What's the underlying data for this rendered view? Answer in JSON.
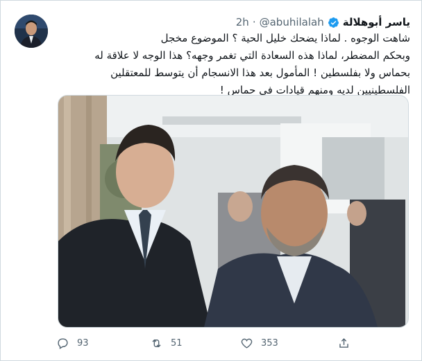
{
  "tweet": {
    "author_name": "ياسر أبوهلالة",
    "handle": "@abuhilalah",
    "separator": "·",
    "time": "2h",
    "text_lines": [
      "شاهت الوجوه .        لماذا يضحك خليل الحية ؟ الموضوع مخجل",
      "وبحكم المضطر، لماذا هذه السعادة التي تغمر وجهه؟ هذا الوجه لا علاقة له",
      "بحماس ولا بفلسطين ! المأمول بعد هذا الانسجام أن يتوسط للمعتقلين",
      "الفلسطينيين لديه ومنهم قيادات في حماس !"
    ],
    "stats": {
      "replies": "93",
      "retweets": "51",
      "likes": "353"
    }
  },
  "icons": {
    "verified": "verified-badge-icon",
    "reply": "reply-icon",
    "retweet": "retweet-icon",
    "like": "heart-icon",
    "share": "share-icon"
  },
  "colors": {
    "verified": "#1d9bf0",
    "muted_text": "#536471",
    "text": "#0f1419",
    "border": "#cfd9de"
  }
}
